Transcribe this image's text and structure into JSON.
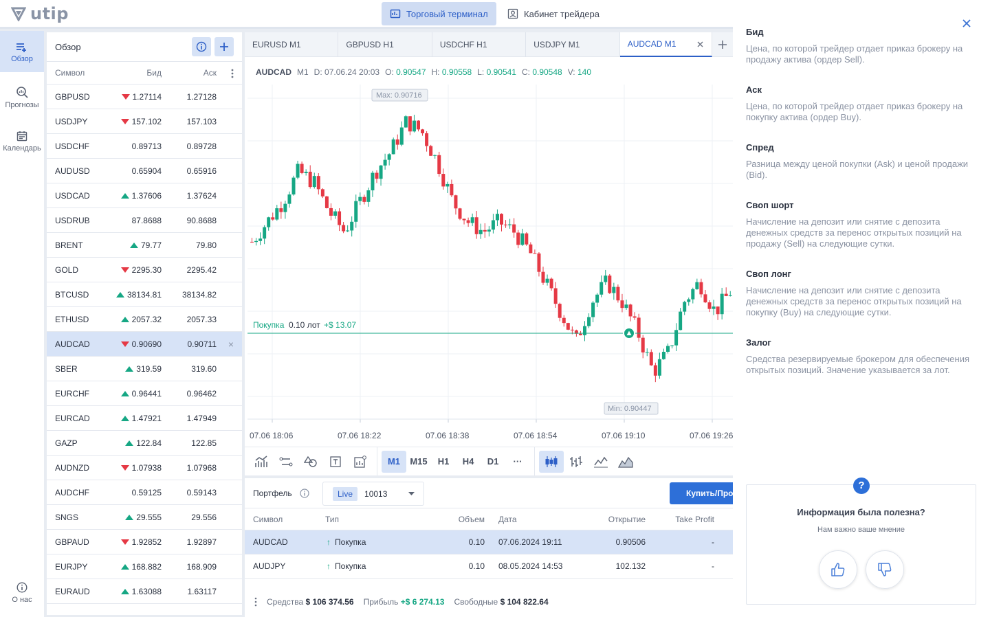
{
  "app": {
    "logo_text": "utip"
  },
  "topnav": {
    "tabs": [
      {
        "label": "Торговый терминал",
        "active": true
      },
      {
        "label": "Кабинет трейдера",
        "active": false
      }
    ]
  },
  "sidebar": {
    "items": [
      {
        "label": "Обзор",
        "icon": "list-add-icon",
        "active": true
      },
      {
        "label": "Прогнозы",
        "icon": "search-chart-icon"
      },
      {
        "label": "Календарь",
        "icon": "calendar-icon"
      },
      {
        "label": "О нас",
        "icon": "info-icon"
      }
    ]
  },
  "watchlist": {
    "title": "Обзор",
    "columns": {
      "symbol": "Символ",
      "bid": "Бид",
      "ask": "Аск"
    },
    "rows": [
      {
        "symbol": "GBPUSD",
        "bid": "1.27114",
        "ask": "1.27128",
        "dir": "down"
      },
      {
        "symbol": "USDJPY",
        "bid": "157.102",
        "ask": "157.103",
        "dir": "down"
      },
      {
        "symbol": "USDCHF",
        "bid": "0.89713",
        "ask": "0.89728",
        "dir": ""
      },
      {
        "symbol": "AUDUSD",
        "bid": "0.65904",
        "ask": "0.65916",
        "dir": ""
      },
      {
        "symbol": "USDCAD",
        "bid": "1.37606",
        "ask": "1.37624",
        "dir": "up"
      },
      {
        "symbol": "USDRUB",
        "bid": "87.8688",
        "ask": "90.8688",
        "dir": ""
      },
      {
        "symbol": "BRENT",
        "bid": "79.77",
        "ask": "79.80",
        "dir": "up"
      },
      {
        "symbol": "GOLD",
        "bid": "2295.30",
        "ask": "2295.42",
        "dir": "down"
      },
      {
        "symbol": "BTCUSD",
        "bid": "38134.81",
        "ask": "38134.82",
        "dir": "up"
      },
      {
        "symbol": "ETHUSD",
        "bid": "2057.32",
        "ask": "2057.33",
        "dir": "up"
      },
      {
        "symbol": "AUDCAD",
        "bid": "0.90690",
        "ask": "0.90711",
        "dir": "down",
        "selected": true
      },
      {
        "symbol": "SBER",
        "bid": "319.59",
        "ask": "319.60",
        "dir": "up"
      },
      {
        "symbol": "EURCHF",
        "bid": "0.96441",
        "ask": "0.96462",
        "dir": "up"
      },
      {
        "symbol": "EURCAD",
        "bid": "1.47921",
        "ask": "1.47949",
        "dir": "up"
      },
      {
        "symbol": "GAZP",
        "bid": "122.84",
        "ask": "122.85",
        "dir": "up"
      },
      {
        "symbol": "AUDNZD",
        "bid": "1.07938",
        "ask": "1.07968",
        "dir": "down"
      },
      {
        "symbol": "AUDCHF",
        "bid": "0.59125",
        "ask": "0.59143",
        "dir": ""
      },
      {
        "symbol": "SNGS",
        "bid": "29.555",
        "ask": "29.556",
        "dir": "up"
      },
      {
        "symbol": "GBPAUD",
        "bid": "1.92852",
        "ask": "1.92897",
        "dir": "down"
      },
      {
        "symbol": "EURJPY",
        "bid": "168.882",
        "ask": "168.909",
        "dir": "up"
      },
      {
        "symbol": "EURAUD",
        "bid": "1.63088",
        "ask": "1.63117",
        "dir": "up"
      }
    ]
  },
  "chart": {
    "tabs": [
      "EURUSD M1",
      "GBPUSD H1",
      "USDCHF H1",
      "USDJPY M1",
      "AUDCAD M1"
    ],
    "active_tab": "AUDCAD M1",
    "ohlc": {
      "symbol": "AUDCAD",
      "tf": "M1",
      "d_label": "D:",
      "d": "07.06.24 20:03",
      "o_label": "O:",
      "o": "0.90547",
      "h_label": "H:",
      "h": "0.90558",
      "l_label": "L:",
      "l": "0.90541",
      "c_label": "C:",
      "c": "0.90548",
      "v_label": "V:",
      "v": "140"
    },
    "max_label": "Max: 0.90716",
    "min_label": "Min: 0.90447",
    "position_label": {
      "side": "Покупка",
      "lots": "0.10 лот",
      "pnl": "+$ 13.07"
    },
    "time_labels": [
      "07.06 18:06",
      "07.06 18:22",
      "07.06 18:38",
      "07.06 18:54",
      "07.06 19:10",
      "07.06 19:26"
    ],
    "timeframes": [
      "M1",
      "M15",
      "H1",
      "H4",
      "D1",
      "···"
    ],
    "active_timeframe": "M1",
    "colors": {
      "up": "#16a784",
      "down": "#e53945"
    }
  },
  "chart_data": {
    "type": "candlestick",
    "x": [
      "07.06 18:06",
      "07.06 18:22",
      "07.06 18:38",
      "07.06 18:54",
      "07.06 19:10",
      "07.06 19:26"
    ],
    "series": [
      {
        "name": "AUDCAD M1",
        "close_path": [
          0.9059,
          0.9061,
          0.9063,
          0.9066,
          0.9065,
          0.9062,
          0.906,
          0.9063,
          0.9066,
          0.9068,
          0.9071,
          0.907,
          0.9067,
          0.9063,
          0.9061,
          0.906,
          0.9061,
          0.906,
          0.9058,
          0.9055,
          0.9052,
          0.9049,
          0.9053,
          0.9055,
          0.9053,
          0.905,
          0.9046,
          0.9048,
          0.9053,
          0.9055,
          0.9052,
          0.9054
        ]
      }
    ],
    "max": 0.90716,
    "min": 0.90447,
    "position_level": 0.9054
  },
  "portfolio": {
    "title": "Портфель",
    "account_type": "Live",
    "account_number": "10013",
    "buy_button": "Купить/Продать",
    "columns": [
      "Символ",
      "Тип",
      "Объем",
      "Дата",
      "Открытие",
      "Take Profit"
    ],
    "rows": [
      {
        "symbol": "AUDCAD",
        "type": "Покупка",
        "volume": "0.10",
        "date": "07.06.2024 19:11",
        "open": "0.90506",
        "tp": "-",
        "selected": true
      },
      {
        "symbol": "AUDJPY",
        "type": "Покупка",
        "volume": "0.10",
        "date": "08.05.2024 14:53",
        "open": "102.132",
        "tp": "-"
      }
    ],
    "footer": {
      "equity_label": "Средства",
      "equity": "$ 106 374.56",
      "profit_label": "Прибыль",
      "profit": "+$ 6 274.13",
      "free_label": "Свободные",
      "free": "$ 104 822.64"
    }
  },
  "glossary": {
    "terms": [
      {
        "title": "Бид",
        "desc": "Цена, по которой трейдер отдает приказ брокеру на продажу актива (ордер Sell)."
      },
      {
        "title": "Аск",
        "desc": "Цена, по которой трейдер отдает приказ брокеру на покупку актива (ордер Buy)."
      },
      {
        "title": "Спред",
        "desc": "Разница между ценой покупки (Ask) и ценой продажи (Bid)."
      },
      {
        "title": "Своп шорт",
        "desc": "Начисление на депозит или снятие с депозита денежных средств за перенос открытых позиций на продажу (Sell) на следующие сутки."
      },
      {
        "title": "Своп лонг",
        "desc": "Начисление на депозит или снятие с депозита денежных средств за перенос открытых позиций на покупку (Buy) на следующие сутки."
      },
      {
        "title": "Залог",
        "desc": "Средства резервируемые брокером для обеспечения открытых позиций. Значение указывается за лот."
      }
    ],
    "feedback": {
      "question": "Информация была полезна?",
      "subtitle": "Нам важно ваше мнение",
      "q_mark": "?"
    }
  }
}
